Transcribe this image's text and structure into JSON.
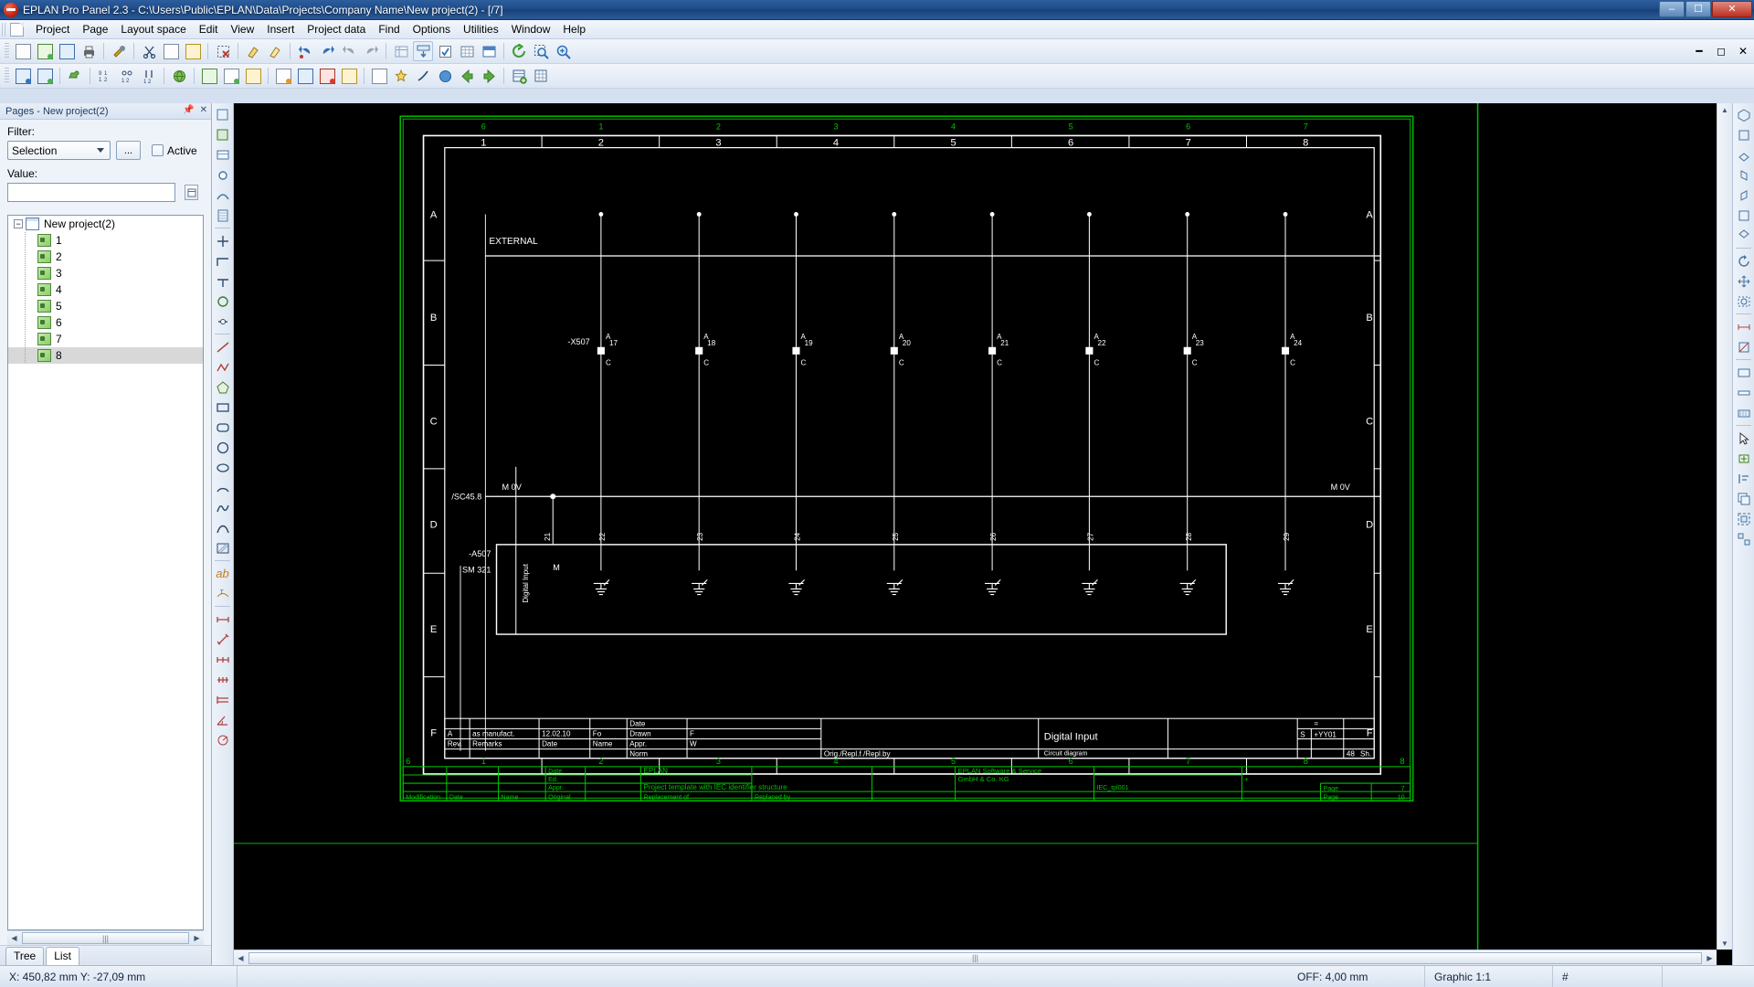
{
  "window": {
    "title": "EPLAN Pro Panel 2.3 - C:\\Users\\Public\\EPLAN\\Data\\Projects\\Company Name\\New project(2) - [/7]",
    "minimize_label": "–",
    "maximize_label": "☐",
    "close_label": "✕"
  },
  "menubar": {
    "items": [
      {
        "label": "Project"
      },
      {
        "label": "Page"
      },
      {
        "label": "Layout space"
      },
      {
        "label": "Edit"
      },
      {
        "label": "View"
      },
      {
        "label": "Insert"
      },
      {
        "label": "Project data"
      },
      {
        "label": "Find"
      },
      {
        "label": "Options"
      },
      {
        "label": "Utilities"
      },
      {
        "label": "Window"
      },
      {
        "label": "Help"
      }
    ]
  },
  "pages_panel": {
    "header": "Pages - New project(2)",
    "filter_label": "Filter:",
    "filter_value": "Selection",
    "ellipsis_button": "...",
    "active_checkbox_label": "Active",
    "value_label": "Value:",
    "value_text": "",
    "value_placeholder": "",
    "tree": {
      "root": "New project(2)",
      "pages": [
        "1",
        "2",
        "3",
        "4",
        "5",
        "6",
        "7",
        "8"
      ],
      "selected": "8"
    },
    "tabs": [
      {
        "label": "Tree",
        "selected": false
      },
      {
        "label": "List",
        "selected": true
      }
    ]
  },
  "statusbar": {
    "coordinates": "X: 450,82 mm   Y: -27,09 mm",
    "offset": "OFF: 4,00 mm",
    "scale": "Graphic 1:1",
    "grid": "#"
  },
  "schematic": {
    "frame_columns_top": [
      "1",
      "2",
      "3",
      "4",
      "5",
      "6",
      "7",
      "8"
    ],
    "frame_columns_bottom": [
      "1",
      "2",
      "3",
      "4",
      "5",
      "6",
      "7",
      "8"
    ],
    "frame_rows": [
      "A",
      "B",
      "C",
      "D",
      "E",
      "F"
    ],
    "corner_left": "6",
    "corner_right": "8",
    "labels": {
      "external": "EXTERNAL",
      "cross_ref_mov": "/SC45.8",
      "mov_left": "M 0V",
      "mov_right": "M 0V",
      "terminal_strip": "-X507",
      "module_designation": "-A507",
      "module_type": "SM 321",
      "module_function": "Digital Input",
      "module_m": "M"
    },
    "terminal_numbers": [
      "17",
      "18",
      "19",
      "20",
      "21",
      "22",
      "23",
      "24"
    ],
    "terminal_letter_top": "A",
    "terminal_letter_bottom": "C",
    "channel_numbers": [
      "21",
      "22",
      "23",
      "24",
      "25",
      "26",
      "27",
      "28",
      "29"
    ],
    "title_block": {
      "rev": "A",
      "remarks": "as manufact.",
      "date": "12.02.10",
      "name": "Fo",
      "col_rev": "Rev.",
      "col_remarks": "Remarks",
      "col_date": "Date",
      "col_name": "Name",
      "row_date": "Date",
      "row_drawn": "Drawn",
      "row_appr": "Appr.",
      "row_norm": "Norm",
      "drawn_value": "F",
      "appr_value": "W",
      "orig_repl": "Orig./Repl.f./Repl.by",
      "doc_title": "Digital Input",
      "doc_subtitle": "Circuit diagram",
      "eq_sign": "=",
      "plus_sign": "+",
      "loc_code": "+YY01",
      "s_code": "S",
      "sheet_no": "48",
      "sheet_label": "Sh."
    },
    "footer_block": {
      "company": "EPLAN",
      "company_full_line1": "EPLAN Software & Service",
      "company_full_line2": "GmbH & Co. KG",
      "template_text": "Project template with IEC identifier structure",
      "col_modification": "Modification",
      "col_date": "Date",
      "col_name": "Name",
      "col_original": "Original",
      "col_replacement": "Replacement of",
      "col_replaced_by": "Replaced by",
      "row_date": "Date",
      "row_ed": "Ed.",
      "row_appr": "Appr.",
      "doc_code": "IEC_tpl001",
      "page_label_1": "Page",
      "page_value_1": "7",
      "page_label_2": "Page",
      "page_value_2": "10"
    }
  },
  "toolbars": {
    "row1": [
      {
        "name": "new-page-icon"
      },
      {
        "name": "open-project-icon"
      },
      {
        "name": "page-navigator-icon"
      },
      {
        "name": "print-icon"
      },
      {
        "name": "settings-wrench-icon"
      },
      {
        "name": "undo-pair-icon"
      },
      {
        "name": "copy-icon"
      },
      {
        "name": "paste-icon"
      },
      {
        "name": "delete-selection-icon"
      },
      {
        "name": "format-brush-icon"
      },
      {
        "name": "format-brush-apply-icon"
      },
      {
        "name": "undo-icon"
      },
      {
        "name": "redo-icon"
      },
      {
        "name": "undo-list-icon"
      },
      {
        "name": "redo-list-icon"
      },
      {
        "name": "grid-snap-icon"
      },
      {
        "name": "object-snap-icon"
      },
      {
        "name": "check-box-icon"
      },
      {
        "name": "grid-display-icon"
      },
      {
        "name": "layer-manager-icon"
      },
      {
        "name": "refresh-icon"
      },
      {
        "name": "zoom-window-icon"
      },
      {
        "name": "zoom-in-icon"
      }
    ],
    "row2": [
      {
        "name": "import-icon"
      },
      {
        "name": "export-icon"
      },
      {
        "name": "plugin-icon"
      },
      {
        "name": "numbering-icon"
      },
      {
        "name": "sort-icon"
      },
      {
        "name": "align-icon"
      },
      {
        "name": "translate-icon"
      },
      {
        "name": "device-list-icon"
      },
      {
        "name": "save-page-icon"
      },
      {
        "name": "macro-icon"
      },
      {
        "name": "edit-text-icon"
      },
      {
        "name": "page-blue-icon"
      },
      {
        "name": "page-delete-icon"
      },
      {
        "name": "page-star-icon"
      },
      {
        "name": "report-icon"
      },
      {
        "name": "generate-icon"
      },
      {
        "name": "wizard-icon"
      },
      {
        "name": "back-icon"
      },
      {
        "name": "forward-icon"
      },
      {
        "name": "navigate-icon"
      },
      {
        "name": "parts-db-icon"
      },
      {
        "name": "table-icon"
      }
    ]
  }
}
